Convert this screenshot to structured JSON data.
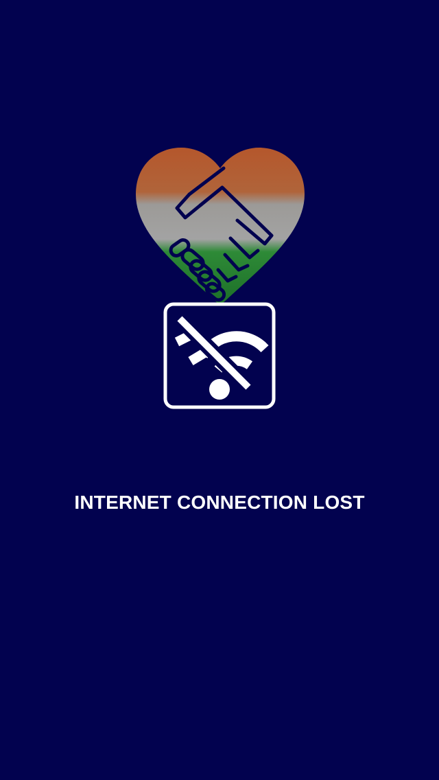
{
  "screen": {
    "background_color": "#02024f",
    "logo_icon": "heart-handshake-tricolor-icon",
    "logo_colors": {
      "saffron": "#b5572c",
      "white": "#a8a8a8",
      "green": "#1f7b2c"
    },
    "status_icon": "wifi-off-icon",
    "message": "INTERNET CONNECTION LOST"
  }
}
